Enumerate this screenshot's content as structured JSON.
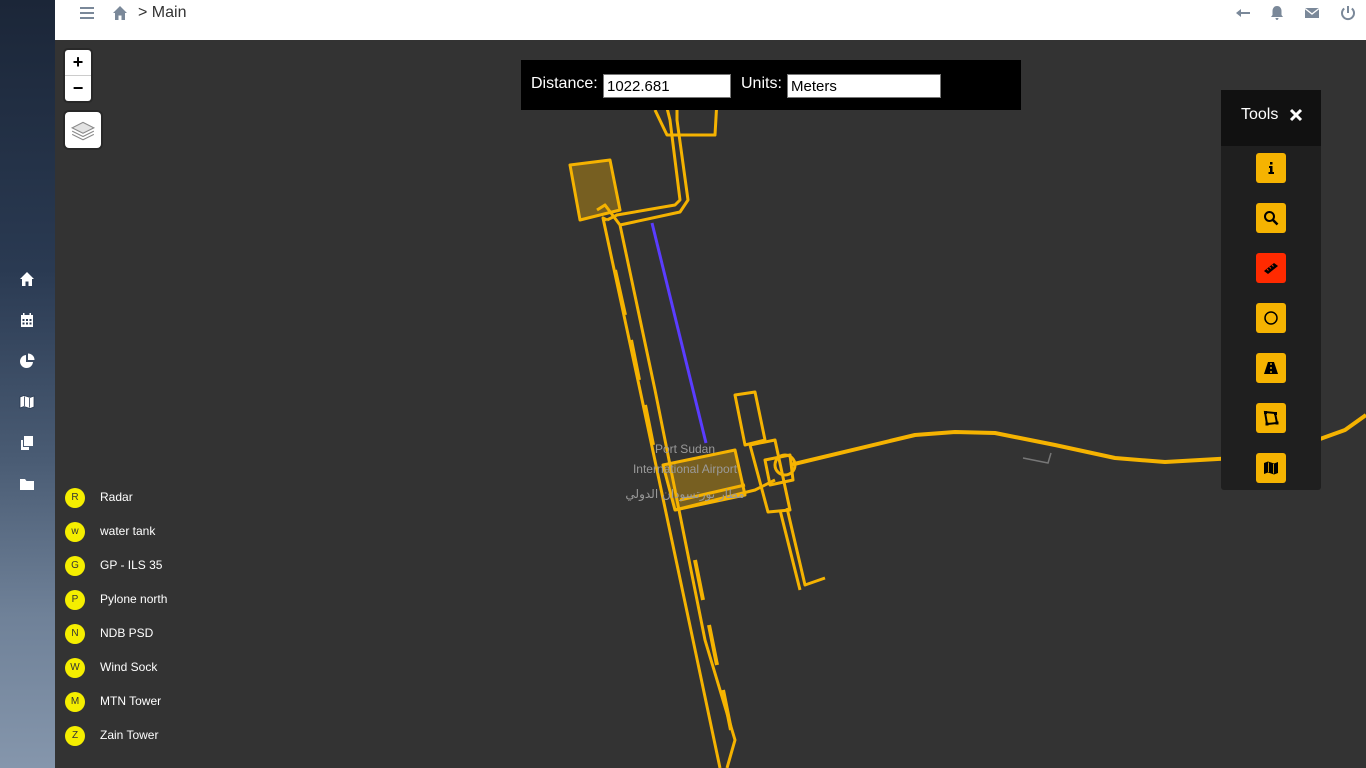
{
  "header": {
    "breadcrumb": "> Main"
  },
  "sidebar": {
    "items": [
      "home-icon",
      "calendar-icon",
      "pie-chart-icon",
      "map-icon",
      "copy-icon",
      "folder-icon"
    ]
  },
  "map": {
    "zoom_in": "+",
    "zoom_out": "−",
    "airport_label_en_1": "Port Sudan",
    "airport_label_en_2": "International Airport",
    "airport_label_ar": "مطار بورتسودان الدولي"
  },
  "distance": {
    "distance_label": "Distance:",
    "distance_value": "1022.681",
    "units_label": "Units:",
    "units_value": "Meters"
  },
  "tools": {
    "title": "Tools",
    "buttons": [
      "info-icon",
      "search-icon",
      "ruler-icon",
      "circle-icon",
      "road-icon",
      "polygon-icon",
      "map-icon"
    ]
  },
  "legend": {
    "items": [
      {
        "letter": "R",
        "label": "Radar"
      },
      {
        "letter": "w",
        "label": "water tank"
      },
      {
        "letter": "G",
        "label": "GP - ILS 35"
      },
      {
        "letter": "P",
        "label": "Pylone north"
      },
      {
        "letter": "N",
        "label": "NDB PSD"
      },
      {
        "letter": "W",
        "label": "Wind Sock"
      },
      {
        "letter": "M",
        "label": "MTN Tower"
      },
      {
        "letter": "Z",
        "label": "Zain Tower"
      }
    ]
  },
  "colors": {
    "accent": "#f5b301",
    "active_tool": "#ff2a00",
    "measure_line": "#5a3cff",
    "legend_dot": "#f5ee00"
  }
}
